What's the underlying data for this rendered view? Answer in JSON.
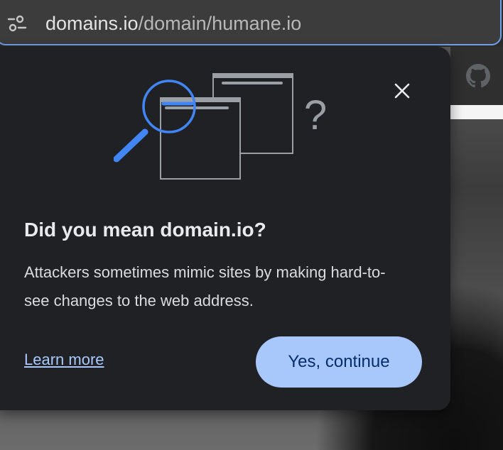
{
  "omnibox": {
    "url_domain": "domains.io",
    "url_path": "/domain/humane.io",
    "tune_icon": "tune-icon"
  },
  "background": {
    "toolbar_icon": "github-icon"
  },
  "popup": {
    "title": "Did you mean domain.io?",
    "description": "Attackers sometimes mimic sites by making hard-to-see changes to the web address.",
    "learn_more_label": "Learn more",
    "continue_label": "Yes, continue",
    "close_icon": "close-icon",
    "illustration": "magnifier-windows-illustration",
    "illustration_mark": "?"
  },
  "colors": {
    "accent": "#a8c7fa",
    "button_text": "#062e6f",
    "popup_bg": "#202124",
    "focus_ring": "#6fa0e8",
    "illustration_blue": "#4285f4"
  }
}
